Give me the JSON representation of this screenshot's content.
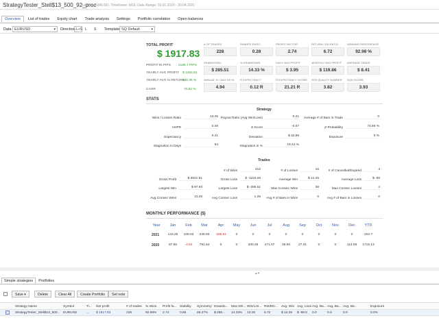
{
  "window": {
    "title": "StrategyTester_Stell$13_500_92_proc",
    "subtitle": "Symbol: EURUSD, Timeframe: M15, Date Range: 02.01.2020 - 30.04.2021"
  },
  "tabs": [
    "Overview",
    "List of trades",
    "Equity chart",
    "Trade analysis",
    "Settings",
    "Portfolio correlation",
    "Open balances"
  ],
  "toolbar": {
    "data_label": "Data",
    "data_value": "EURUSD",
    "direction_label": "Direction",
    "direction_options": [
      "L+S",
      "L",
      "S"
    ],
    "template_label": "Template",
    "template_value": "SQ Default"
  },
  "summary": {
    "total_profit_label": "TOTAL PROFIT",
    "total_profit_value": "$ 1917.83",
    "rows": [
      {
        "label": "PROFIT IN PIPS",
        "value": "2186.7 PIPS"
      },
      {
        "label": "YEARLY AVG PROFIT",
        "value": "$ 1463.51"
      },
      {
        "label": "YEARLY AVG % RETURN",
        "value": "146.35 %"
      },
      {
        "label": "CAGR",
        "value": "70.82 %"
      }
    ]
  },
  "metrics": [
    {
      "label": "# OF TRADES",
      "value": "228"
    },
    {
      "label": "SHARPE RATIO",
      "value": "0.28"
    },
    {
      "label": "PROFIT FACTOR",
      "value": "2.74"
    },
    {
      "label": "RETURN / DD RATIO",
      "value": "6.72"
    },
    {
      "label": "WINNING PERCENTAGE",
      "value": "92.98 %"
    },
    {
      "label": "DRAWDOWN",
      "value": "$ 285.51"
    },
    {
      "label": "% DRAWDOWN",
      "value": "14.33 %"
    },
    {
      "label": "DAILY AVG PROFIT",
      "value": "$ 3.95"
    },
    {
      "label": "MONTHLY AVG PROFIT",
      "value": "$ 119.86"
    },
    {
      "label": "AVERAGE TRADE",
      "value": "$ 8.41"
    },
    {
      "label": "ANNUAL % / MAX DD %",
      "value": "4.94"
    },
    {
      "label": "R EXPECTANCY",
      "value": "0.12 R"
    },
    {
      "label": "R EXPECTANCY SCORE",
      "value": "21.21 R"
    },
    {
      "label": "STR QUALITY NUMBER",
      "value": "3.82"
    },
    {
      "label": "SQN SCORE",
      "value": "3.93"
    }
  ],
  "stats_title": "STATS",
  "strategy": {
    "title": "Strategy",
    "col1": [
      {
        "label": "Wins / Losses Ratio",
        "value": "13.25"
      },
      {
        "label": "AHPR",
        "value": "0.48"
      },
      {
        "label": "Expectancy",
        "value": "0.41"
      },
      {
        "label": "Stagnation in Days",
        "value": "94"
      }
    ],
    "col2": [
      {
        "label": "Payout Ratio (Avg Win/Loss)",
        "value": "0.21"
      },
      {
        "label": "Z-Score",
        "value": "-0.67"
      },
      {
        "label": "Deviation",
        "value": "$ 32.99"
      },
      {
        "label": "Stagnation in %",
        "value": "19.42 %"
      }
    ],
    "col3": [
      {
        "label": "Average # of Bars in Trade",
        "value": "0"
      },
      {
        "label": "Z-Probability",
        "value": "74.86 %"
      },
      {
        "label": "Exposure",
        "value": "0 %"
      }
    ]
  },
  "trades": {
    "title": "Trades",
    "col1": [
      {
        "label": "",
        "value": ""
      },
      {
        "label": "Gross Profit",
        "value": "$ 3021.91"
      },
      {
        "label": "Largest Win",
        "value": "$ 97.93"
      },
      {
        "label": "Avg Consec Wins",
        "value": "13.25"
      }
    ],
    "col2": [
      {
        "label": "# of Wins",
        "value": "212"
      },
      {
        "label": "Gross Loss",
        "value": "$ -1104.08"
      },
      {
        "label": "Largest Loss",
        "value": "$ -285.51"
      },
      {
        "label": "Avg Consec Loss",
        "value": "1.25"
      }
    ],
    "col3": [
      {
        "label": "# of Losses",
        "value": "16"
      },
      {
        "label": "Average Win",
        "value": "$ 14.25"
      },
      {
        "label": "Max Consec Wins",
        "value": "38"
      },
      {
        "label": "Avg # of Bars in Wins",
        "value": "0"
      }
    ],
    "col4": [
      {
        "label": "# of Cancelled/Expired",
        "value": "4"
      },
      {
        "label": "Average Loss",
        "value": "$ -69"
      },
      {
        "label": "Max Consec Losses",
        "value": "4"
      },
      {
        "label": "Avg # of Bars in Losses",
        "value": "0"
      }
    ]
  },
  "monthly": {
    "title": "MONTHLY PERFORMANCE ($)",
    "headers": [
      "Year",
      "Jan",
      "Feb",
      "Mar",
      "Apr",
      "May",
      "Jun",
      "Jul",
      "Aug",
      "Sep",
      "Oct",
      "Nov",
      "Dec",
      "YTD"
    ],
    "rows": [
      {
        "year": "2021",
        "values": [
          "143.25",
          "100.03",
          "236.93",
          "-285.51",
          "0",
          "0",
          "0",
          "0",
          "0",
          "0",
          "0",
          "0",
          "202.7"
        ]
      },
      {
        "year": "2020",
        "values": [
          "87.65",
          "-4.64",
          "791.64",
          "0",
          "0",
          "200.26",
          "471.07",
          "28.56",
          "27.31",
          "0",
          "0",
          "113.08",
          "1715.13"
        ]
      }
    ]
  },
  "bottom_tabs": [
    "Simple strategies",
    "Portfolios"
  ],
  "buttons": [
    "Save",
    "Delete",
    "Clear All",
    "Create Portfolio",
    "Set note"
  ],
  "grid": {
    "headers": [
      "Strategy Name",
      "Symbol",
      "Ti...",
      "Net profit",
      "# of trades",
      "% Wins",
      "Profit fa...",
      "Stability",
      "Symmetry",
      "Drawdo...",
      "Max DD...",
      "Win/Los...",
      "Ret/DD...",
      "Avg. Win",
      "Avg. Loss",
      "Avg. Ba...",
      "Avg. Ba...",
      "Avg. Ba...",
      "Exposure"
    ],
    "row": [
      "StrategyTester_Stell$13_500...",
      "EURUSD",
      "...",
      "$ 1917.83",
      "228",
      "92.98%",
      "2.74",
      "0.85",
      "68.27%",
      "$ 285...",
      "14.33%",
      "13.25",
      "6.72",
      "$ 14.25",
      "$ -89.0",
      "0.0",
      "0.0",
      "0.0",
      "0.0%"
    ]
  },
  "colors": {
    "accent": "#2b5aa0",
    "positive": "#2e9a2e",
    "negative": "#d03030"
  }
}
